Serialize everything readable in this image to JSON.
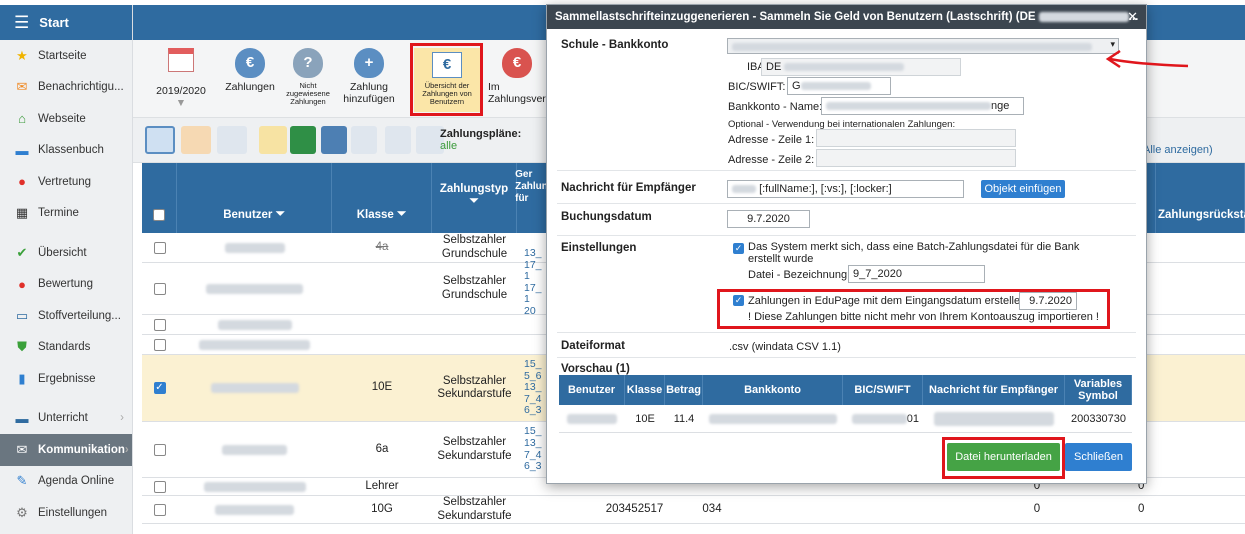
{
  "sidebar": {
    "title": "Start",
    "items": [
      {
        "label": "Startseite",
        "icon": "star-icon",
        "color": "#f0b400"
      },
      {
        "label": "Benachrichtigu...",
        "icon": "envelope-icon",
        "color": "#f08a24"
      },
      {
        "label": "Webseite",
        "icon": "home-icon",
        "color": "#3a9a3a"
      },
      {
        "label": "Klassenbuch",
        "icon": "book-icon",
        "color": "#2f7fd0"
      },
      {
        "label": "Vertretung",
        "icon": "person-icon",
        "color": "#e0302a"
      },
      {
        "label": "Termine",
        "icon": "calendar-icon",
        "color": "#333333"
      },
      {
        "label": "Übersicht",
        "icon": "check-circle-icon",
        "color": "#3aa03a"
      },
      {
        "label": "Bewertung",
        "icon": "grade-icon",
        "color": "#e0302a"
      },
      {
        "label": "Stoffverteilung...",
        "icon": "briefcase-icon",
        "color": "#2f6ba0"
      },
      {
        "label": "Standards",
        "icon": "shield-icon",
        "color": "#3aa03a"
      },
      {
        "label": "Ergebnisse",
        "icon": "bar-chart-icon",
        "color": "#2f7fd0"
      },
      {
        "label": "Unterricht",
        "icon": "school-icon",
        "color": "#2f6ba0"
      },
      {
        "label": "Kommunikation",
        "icon": "chat-icon",
        "color": "#ffffff"
      },
      {
        "label": "Agenda Online",
        "icon": "pen-icon",
        "color": "#2f7fd0"
      },
      {
        "label": "Einstellungen",
        "icon": "gear-icon",
        "color": "#777777"
      }
    ]
  },
  "toolbar": {
    "year": "2019/2020",
    "items": [
      {
        "label": "Zahlungen",
        "icon": "money-bag-icon"
      },
      {
        "label": "Nicht zugewiesene Zahlungen",
        "icon": "money-bag-question-icon"
      },
      {
        "label": "Zahlung hinzufügen",
        "icon": "money-bag-plus-icon"
      },
      {
        "label": "Übersicht der Zahlungen von Benutzern",
        "icon": "euro-book-icon"
      },
      {
        "label": "Im Zahlungsverz",
        "icon": "money-bag-clock-icon"
      }
    ]
  },
  "filterbar": {
    "plans_label": "Zahlungspläne:",
    "plans_value": "alle",
    "show_all": "Alle anzeigen)"
  },
  "grid": {
    "headers": {
      "user": "Benutzer",
      "class": "Klasse",
      "paytype": "Zahlungstyp",
      "gen": "Ger Zahlun für",
      "arrears": "Zahlungsrückstand"
    },
    "rows": [
      {
        "klasse": "4a",
        "typ": "Selbstzahler Grundschule",
        "links": "",
        "z": "0",
        "struck": true
      },
      {
        "klasse": "",
        "typ": "Selbstzahler Grundschule",
        "links": "13_ 17_1 17_1 20_1",
        "z": "0"
      },
      {
        "klasse": "",
        "typ": "",
        "links": "",
        "z": "0"
      },
      {
        "klasse": "",
        "typ": "",
        "links": "",
        "z": "0"
      },
      {
        "klasse": "10E",
        "typ": "Selbstzahler Sekundarstufe",
        "links": "15_ 5_6 13_ 7_4 6_3",
        "z": "0",
        "selected": true
      },
      {
        "klasse": "6a",
        "typ": "Selbstzahler Sekundarstufe",
        "links": "15_ 13_ 7_4 6_3",
        "z": "0"
      },
      {
        "klasse": "Lehrer",
        "typ": "",
        "links": "",
        "z": "0",
        "z2": "0"
      },
      {
        "klasse": "10G",
        "typ": "Selbstzahler Sekundarstufe",
        "links": "",
        "vs": "203452517",
        "code": "034",
        "z": "0",
        "z2": "0"
      }
    ]
  },
  "modal": {
    "title": "Sammellastschrifteinzuggenerieren - Sammeln Sie Geld von Benutzern (Lastschrift) (DE",
    "school_label": "Schule - Bankkonto",
    "iban_label": "IBAN:",
    "iban_value": "DE",
    "bic_label": "BIC/SWIFT:",
    "bic_value": "G",
    "account_name_label": "Bankkonto - Name:",
    "account_name_value": "nge",
    "optional_note": "Optional - Verwendung bei internationalen Zahlungen:",
    "addr1_label": "Adresse - Zeile 1:",
    "addr2_label": "Adresse - Zeile 2:",
    "message_label": "Nachricht für Empfänger",
    "message_value": "[:fullName:], [:vs:], [:locker:]",
    "insert_object_button": "Objekt einfügen",
    "booking_date_label": "Buchungsdatum",
    "booking_date_value": "9.7.2020",
    "settings_label": "Einstellungen",
    "remember_text": "Das System merkt sich, dass eine Batch-Zahlungsdatei für die Bank erstellt wurde",
    "file_name_label": "Datei - Bezeichnung:",
    "file_name_value": "9_7_2020",
    "create_payments_text": "Zahlungen in EduPage mit dem Eingangsdatum erstellen",
    "create_payments_date": "9.7.2020",
    "warning_text": "! Diese Zahlungen bitte nicht mehr von Ihrem Kontoauszug importieren !",
    "format_label": "Dateiformat",
    "format_value": ".csv (windata CSV 1.1)",
    "preview_label": "Vorschau (1)",
    "preview_headers": [
      "Benutzer",
      "Klasse",
      "Betrag",
      "Bankkonto",
      "BIC/SWIFT",
      "Nachricht für Empfänger",
      "Variables Symbol"
    ],
    "preview_row": {
      "klasse": "10E",
      "betrag": "11.4",
      "bic_tail": "01",
      "vs": "200330730"
    },
    "download_button": "Datei herunterladen",
    "close_button": "Schließen"
  }
}
